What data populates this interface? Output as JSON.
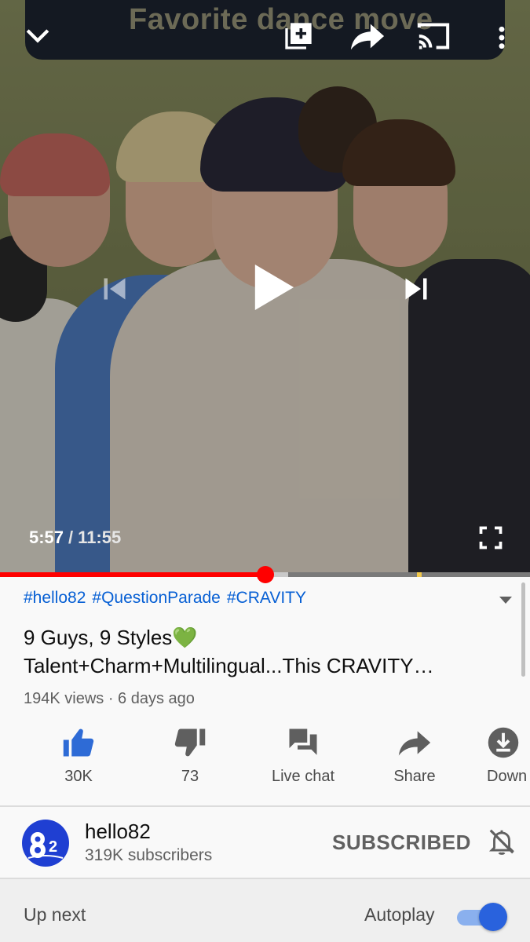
{
  "player": {
    "caption_overlay": "Favorite dance move",
    "current_time": "5:57",
    "separator": "/",
    "duration": "11:55",
    "progress_fraction": 0.5,
    "top_icons": [
      "chevron-down-icon",
      "add-to-playlist-icon",
      "share-icon",
      "cast-icon",
      "more-vert-icon"
    ],
    "center_controls": [
      "previous-icon",
      "play-icon",
      "next-icon"
    ],
    "fullscreen_icon": "fullscreen-icon",
    "played_color": "#ff0000"
  },
  "video": {
    "hashtags": [
      "#hello82",
      "#QuestionParade",
      "#CRAVITY"
    ],
    "title_line1": "9 Guys, 9 Styles💚",
    "title_line2": "Talent+Charm+Multilingual...This CRAVITY…",
    "meta": "194K views · 6 days ago"
  },
  "actions": [
    {
      "icon": "thumb-up-icon",
      "label": "30K",
      "active": true
    },
    {
      "icon": "thumb-down-icon",
      "label": "73",
      "active": false
    },
    {
      "icon": "live-chat-icon",
      "label": "Live chat",
      "active": false
    },
    {
      "icon": "share-icon",
      "label": "Share",
      "active": false
    },
    {
      "icon": "download-icon",
      "label": "Down",
      "active": false
    }
  ],
  "channel": {
    "name": "hello82",
    "subscribers": "319K subscribers",
    "subscribe_state": "SUBSCRIBED",
    "avatar_text": "82",
    "avatar_color": "#1f3fd2"
  },
  "upnext": {
    "label": "Up next",
    "autoplay_label": "Autoplay",
    "autoplay_on": true
  },
  "colors": {
    "link": "#065fd4",
    "like_active": "#2e6bd6",
    "toggle_knob": "#2962dd"
  }
}
